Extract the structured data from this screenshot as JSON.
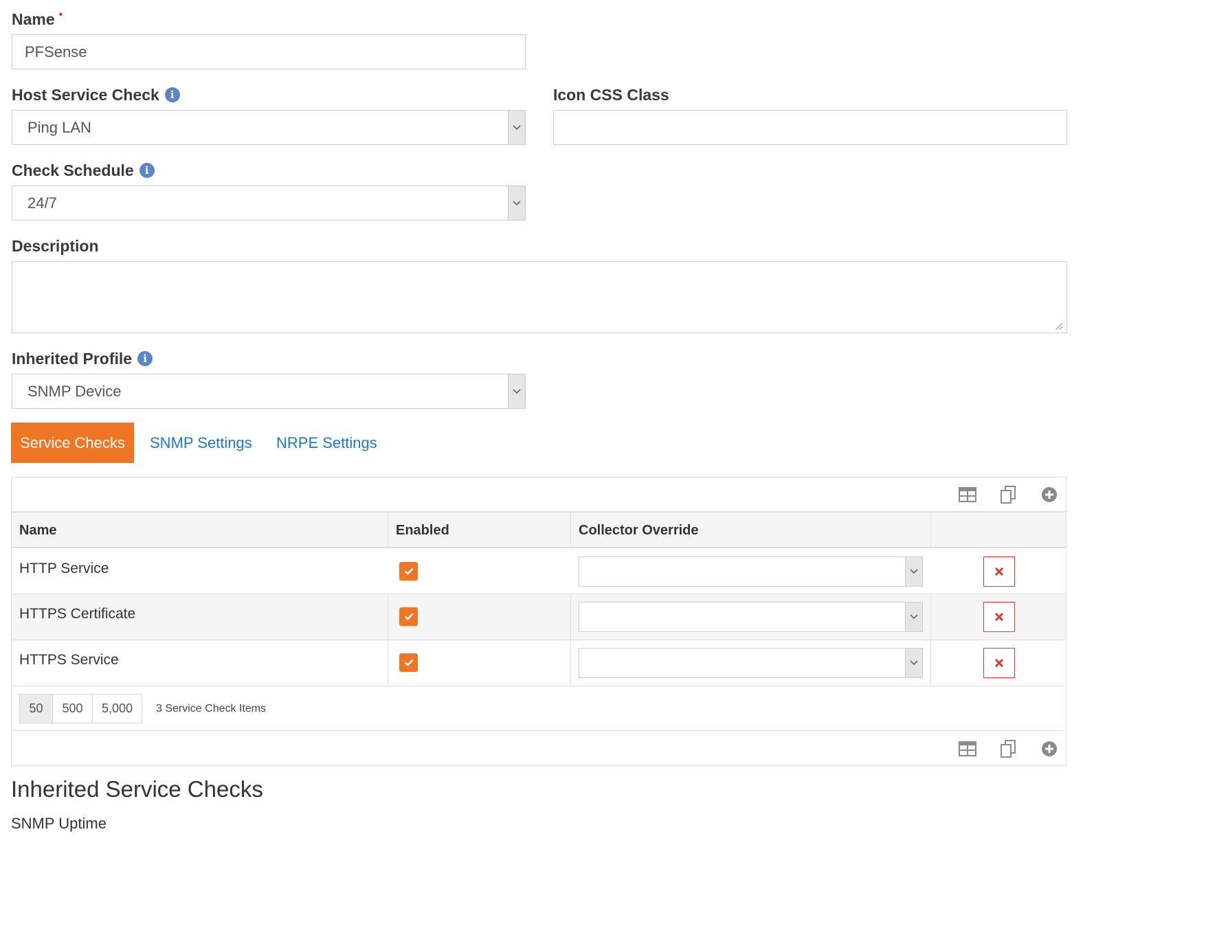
{
  "form": {
    "name_label": "Name",
    "required_mark": "•",
    "name_value": "PFSense",
    "host_service_check_label": "Host Service Check",
    "host_service_check_value": "Ping LAN",
    "icon_css_class_label": "Icon CSS Class",
    "icon_css_class_value": "",
    "check_schedule_label": "Check Schedule",
    "check_schedule_value": "24/7",
    "description_label": "Description",
    "description_value": "",
    "inherited_profile_label": "Inherited Profile",
    "inherited_profile_value": "SNMP Device",
    "info_glyph": "i"
  },
  "tabs": [
    {
      "label": "Service Checks",
      "active": true
    },
    {
      "label": "SNMP Settings",
      "active": false
    },
    {
      "label": "NRPE Settings",
      "active": false
    }
  ],
  "grid": {
    "columns": [
      "Name",
      "Enabled",
      "Collector Override",
      ""
    ],
    "rows": [
      {
        "name": "HTTP Service",
        "enabled": true,
        "collector_override": ""
      },
      {
        "name": "HTTPS Certificate",
        "enabled": true,
        "collector_override": ""
      },
      {
        "name": "HTTPS Service",
        "enabled": true,
        "collector_override": ""
      }
    ],
    "page_sizes": [
      "50",
      "500",
      "5,000"
    ],
    "active_page_size": "50",
    "item_count_text": "3 Service Check Items",
    "icons": {
      "grid": "table-icon",
      "copy": "copy-icon",
      "add": "plus-circle-icon",
      "delete": "times-icon",
      "check": "check-icon",
      "dropdown": "chevron-down-icon"
    }
  },
  "inherited": {
    "heading": "Inherited Service Checks",
    "items": [
      "SNMP Uptime"
    ]
  },
  "colors": {
    "accent": "#ee7624",
    "link": "#1a7ac9",
    "danger": "#d63c2f",
    "info": "#5b86c5"
  }
}
